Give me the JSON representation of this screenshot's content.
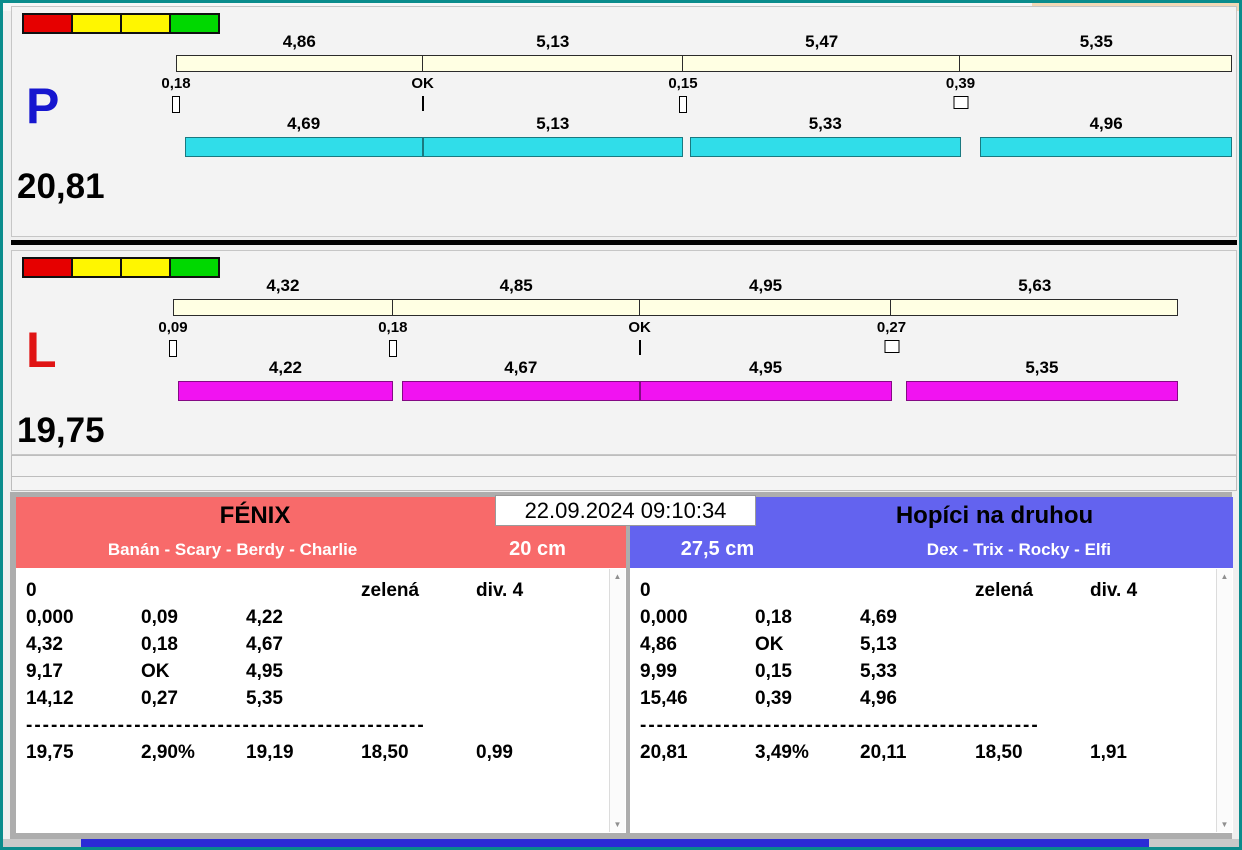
{
  "window": {
    "datetime": "22.09.2024 09:10:34"
  },
  "icons": {
    "scroll_up": "▲",
    "scroll_down": "▼"
  },
  "lanes": {
    "lane_p": {
      "label": "P",
      "label_color": "#1616cf",
      "total": "20,81",
      "splits_top": [
        "4,86",
        "5,13",
        "5,47",
        "5,35"
      ],
      "changes": [
        "0,18",
        "OK",
        "0,15",
        "0,39"
      ],
      "change_markers": [
        "box",
        "line",
        "box",
        "box-wide"
      ],
      "splits_bottom": [
        "4,69",
        "5,13",
        "5,33",
        "4,96"
      ],
      "bar_color": "#30dde9",
      "lights": [
        "#e60000",
        "#fff600",
        "#fff600",
        "#00d800"
      ]
    },
    "lane_l": {
      "label": "L",
      "label_color": "#e01414",
      "total": "19,75",
      "splits_top": [
        "4,32",
        "4,85",
        "4,95",
        "5,63"
      ],
      "changes": [
        "0,09",
        "0,18",
        "OK",
        "0,27"
      ],
      "change_markers": [
        "box",
        "box",
        "line",
        "box-wide"
      ],
      "splits_bottom": [
        "4,22",
        "4,67",
        "4,95",
        "5,35"
      ],
      "bar_color": "#f113f1",
      "lights": [
        "#e60000",
        "#fff600",
        "#fff600",
        "#00d800"
      ]
    }
  },
  "teams": {
    "left": {
      "name": "FÉNIX",
      "members": "Banán - Scary - Berdy - Charlie",
      "height": "20 cm",
      "header_color": "#f86a6a",
      "result_rows": [
        [
          "0",
          "",
          "",
          "zelená",
          "div. 4"
        ],
        [
          "0,000",
          "0,09",
          "4,22",
          "",
          ""
        ],
        [
          "4,32",
          "0,18",
          "4,67",
          "",
          ""
        ],
        [
          "9,17",
          "OK",
          "4,95",
          "",
          ""
        ],
        [
          "14,12",
          "0,27",
          "5,35",
          "",
          ""
        ]
      ],
      "separator": "------------------------------------------------",
      "summary_row": [
        "19,75",
        "2,90%",
        "19,19",
        "18,50",
        "0,99"
      ]
    },
    "right": {
      "name": "Hopíci na druhou",
      "members": "Dex - Trix - Rocky - Elfi",
      "height": "27,5 cm",
      "header_color": "#6363ef",
      "result_rows": [
        [
          "0",
          "",
          "",
          "zelená",
          "div. 4"
        ],
        [
          "0,000",
          "0,18",
          "4,69",
          "",
          ""
        ],
        [
          "4,86",
          "OK",
          "5,13",
          "",
          ""
        ],
        [
          "9,99",
          "0,15",
          "5,33",
          "",
          ""
        ],
        [
          "15,46",
          "0,39",
          "4,96",
          "",
          ""
        ]
      ],
      "separator": "------------------------------------------------",
      "summary_row": [
        "20,81",
        "3,49%",
        "20,11",
        "18,50",
        "1,91"
      ]
    }
  }
}
